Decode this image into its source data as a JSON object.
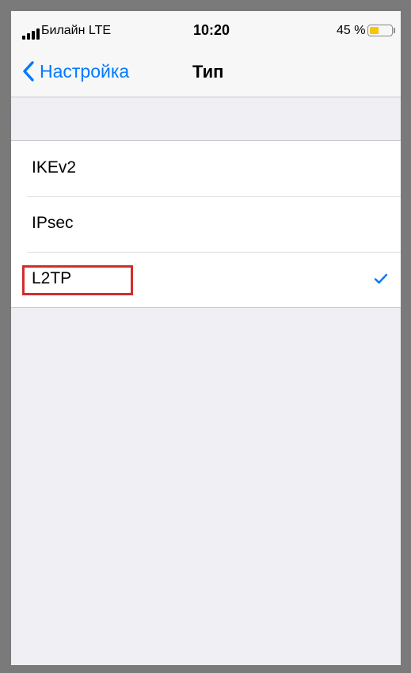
{
  "status_bar": {
    "carrier": "Билайн  LTE",
    "time": "10:20",
    "battery_percent": "45 %",
    "battery_level": 0.45,
    "icons": [
      "signal-icon",
      "battery-icon"
    ]
  },
  "nav": {
    "back_label": "Настройка",
    "title": "Тип",
    "back_icon": "chevron-left-icon"
  },
  "options": [
    {
      "label": "IKEv2",
      "selected": false
    },
    {
      "label": "IPsec",
      "selected": false
    },
    {
      "label": "L2TP",
      "selected": true,
      "highlighted": true
    }
  ],
  "colors": {
    "accent": "#007aff",
    "background": "#efeff4",
    "highlight": "#d22d2d",
    "battery": "#f6c700"
  }
}
